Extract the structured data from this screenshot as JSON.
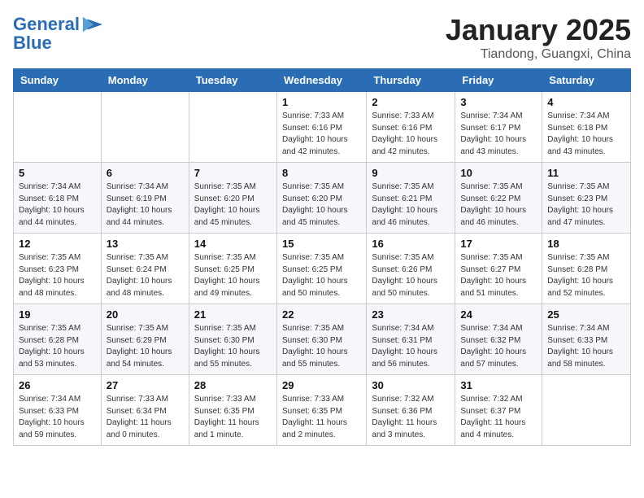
{
  "logo": {
    "line1": "General",
    "line2": "Blue"
  },
  "title": "January 2025",
  "subtitle": "Tiandong, Guangxi, China",
  "days_of_week": [
    "Sunday",
    "Monday",
    "Tuesday",
    "Wednesday",
    "Thursday",
    "Friday",
    "Saturday"
  ],
  "weeks": [
    [
      {
        "day": "",
        "info": ""
      },
      {
        "day": "",
        "info": ""
      },
      {
        "day": "",
        "info": ""
      },
      {
        "day": "1",
        "info": "Sunrise: 7:33 AM\nSunset: 6:16 PM\nDaylight: 10 hours and 42 minutes."
      },
      {
        "day": "2",
        "info": "Sunrise: 7:33 AM\nSunset: 6:16 PM\nDaylight: 10 hours and 42 minutes."
      },
      {
        "day": "3",
        "info": "Sunrise: 7:34 AM\nSunset: 6:17 PM\nDaylight: 10 hours and 43 minutes."
      },
      {
        "day": "4",
        "info": "Sunrise: 7:34 AM\nSunset: 6:18 PM\nDaylight: 10 hours and 43 minutes."
      }
    ],
    [
      {
        "day": "5",
        "info": "Sunrise: 7:34 AM\nSunset: 6:18 PM\nDaylight: 10 hours and 44 minutes."
      },
      {
        "day": "6",
        "info": "Sunrise: 7:34 AM\nSunset: 6:19 PM\nDaylight: 10 hours and 44 minutes."
      },
      {
        "day": "7",
        "info": "Sunrise: 7:35 AM\nSunset: 6:20 PM\nDaylight: 10 hours and 45 minutes."
      },
      {
        "day": "8",
        "info": "Sunrise: 7:35 AM\nSunset: 6:20 PM\nDaylight: 10 hours and 45 minutes."
      },
      {
        "day": "9",
        "info": "Sunrise: 7:35 AM\nSunset: 6:21 PM\nDaylight: 10 hours and 46 minutes."
      },
      {
        "day": "10",
        "info": "Sunrise: 7:35 AM\nSunset: 6:22 PM\nDaylight: 10 hours and 46 minutes."
      },
      {
        "day": "11",
        "info": "Sunrise: 7:35 AM\nSunset: 6:23 PM\nDaylight: 10 hours and 47 minutes."
      }
    ],
    [
      {
        "day": "12",
        "info": "Sunrise: 7:35 AM\nSunset: 6:23 PM\nDaylight: 10 hours and 48 minutes."
      },
      {
        "day": "13",
        "info": "Sunrise: 7:35 AM\nSunset: 6:24 PM\nDaylight: 10 hours and 48 minutes."
      },
      {
        "day": "14",
        "info": "Sunrise: 7:35 AM\nSunset: 6:25 PM\nDaylight: 10 hours and 49 minutes."
      },
      {
        "day": "15",
        "info": "Sunrise: 7:35 AM\nSunset: 6:25 PM\nDaylight: 10 hours and 50 minutes."
      },
      {
        "day": "16",
        "info": "Sunrise: 7:35 AM\nSunset: 6:26 PM\nDaylight: 10 hours and 50 minutes."
      },
      {
        "day": "17",
        "info": "Sunrise: 7:35 AM\nSunset: 6:27 PM\nDaylight: 10 hours and 51 minutes."
      },
      {
        "day": "18",
        "info": "Sunrise: 7:35 AM\nSunset: 6:28 PM\nDaylight: 10 hours and 52 minutes."
      }
    ],
    [
      {
        "day": "19",
        "info": "Sunrise: 7:35 AM\nSunset: 6:28 PM\nDaylight: 10 hours and 53 minutes."
      },
      {
        "day": "20",
        "info": "Sunrise: 7:35 AM\nSunset: 6:29 PM\nDaylight: 10 hours and 54 minutes."
      },
      {
        "day": "21",
        "info": "Sunrise: 7:35 AM\nSunset: 6:30 PM\nDaylight: 10 hours and 55 minutes."
      },
      {
        "day": "22",
        "info": "Sunrise: 7:35 AM\nSunset: 6:30 PM\nDaylight: 10 hours and 55 minutes."
      },
      {
        "day": "23",
        "info": "Sunrise: 7:34 AM\nSunset: 6:31 PM\nDaylight: 10 hours and 56 minutes."
      },
      {
        "day": "24",
        "info": "Sunrise: 7:34 AM\nSunset: 6:32 PM\nDaylight: 10 hours and 57 minutes."
      },
      {
        "day": "25",
        "info": "Sunrise: 7:34 AM\nSunset: 6:33 PM\nDaylight: 10 hours and 58 minutes."
      }
    ],
    [
      {
        "day": "26",
        "info": "Sunrise: 7:34 AM\nSunset: 6:33 PM\nDaylight: 10 hours and 59 minutes."
      },
      {
        "day": "27",
        "info": "Sunrise: 7:33 AM\nSunset: 6:34 PM\nDaylight: 11 hours and 0 minutes."
      },
      {
        "day": "28",
        "info": "Sunrise: 7:33 AM\nSunset: 6:35 PM\nDaylight: 11 hours and 1 minute."
      },
      {
        "day": "29",
        "info": "Sunrise: 7:33 AM\nSunset: 6:35 PM\nDaylight: 11 hours and 2 minutes."
      },
      {
        "day": "30",
        "info": "Sunrise: 7:32 AM\nSunset: 6:36 PM\nDaylight: 11 hours and 3 minutes."
      },
      {
        "day": "31",
        "info": "Sunrise: 7:32 AM\nSunset: 6:37 PM\nDaylight: 11 hours and 4 minutes."
      },
      {
        "day": "",
        "info": ""
      }
    ]
  ]
}
